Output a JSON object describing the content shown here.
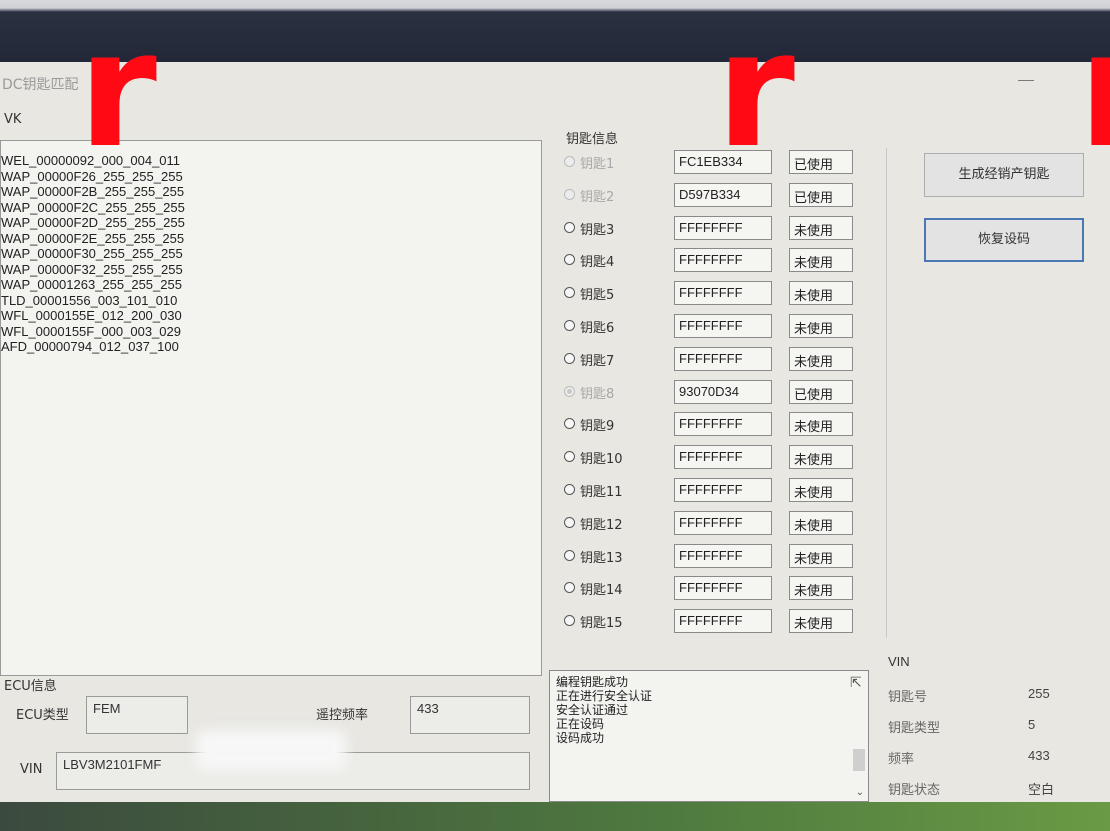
{
  "window": {
    "title": "DC钥匙匹配"
  },
  "list_panel": {
    "label": "VK",
    "items": [
      "WEL_00000092_000_004_011",
      "WAP_00000F26_255_255_255",
      "WAP_00000F2B_255_255_255",
      "WAP_00000F2C_255_255_255",
      "WAP_00000F2D_255_255_255",
      "WAP_00000F2E_255_255_255",
      "WAP_00000F30_255_255_255",
      "WAP_00000F32_255_255_255",
      "WAP_00001263_255_255_255",
      "TLD_00001556_003_101_010",
      "WFL_0000155E_012_200_030",
      "WFL_0000155F_000_003_029",
      "AFD_00000794_012_037_100"
    ]
  },
  "key_info": {
    "label": "钥匙信息",
    "keys": [
      {
        "name": "钥匙1",
        "code": "FC1EB334",
        "status": "已使用",
        "enabled": false,
        "checked": false
      },
      {
        "name": "钥匙2",
        "code": "D597B334",
        "status": "已使用",
        "enabled": false,
        "checked": false
      },
      {
        "name": "钥匙3",
        "code": "FFFFFFFF",
        "status": "未使用",
        "enabled": true,
        "checked": false
      },
      {
        "name": "钥匙4",
        "code": "FFFFFFFF",
        "status": "未使用",
        "enabled": true,
        "checked": false
      },
      {
        "name": "钥匙5",
        "code": "FFFFFFFF",
        "status": "未使用",
        "enabled": true,
        "checked": false
      },
      {
        "name": "钥匙6",
        "code": "FFFFFFFF",
        "status": "未使用",
        "enabled": true,
        "checked": false
      },
      {
        "name": "钥匙7",
        "code": "FFFFFFFF",
        "status": "未使用",
        "enabled": true,
        "checked": false
      },
      {
        "name": "钥匙8",
        "code": "93070D34",
        "status": "已使用",
        "enabled": false,
        "checked": true
      },
      {
        "name": "钥匙9",
        "code": "FFFFFFFF",
        "status": "未使用",
        "enabled": true,
        "checked": false
      },
      {
        "name": "钥匙10",
        "code": "FFFFFFFF",
        "status": "未使用",
        "enabled": true,
        "checked": false
      },
      {
        "name": "钥匙11",
        "code": "FFFFFFFF",
        "status": "未使用",
        "enabled": true,
        "checked": false
      },
      {
        "name": "钥匙12",
        "code": "FFFFFFFF",
        "status": "未使用",
        "enabled": true,
        "checked": false
      },
      {
        "name": "钥匙13",
        "code": "FFFFFFFF",
        "status": "未使用",
        "enabled": true,
        "checked": false
      },
      {
        "name": "钥匙14",
        "code": "FFFFFFFF",
        "status": "未使用",
        "enabled": true,
        "checked": false
      },
      {
        "name": "钥匙15",
        "code": "FFFFFFFF",
        "status": "未使用",
        "enabled": true,
        "checked": false
      }
    ]
  },
  "buttons": {
    "generate_label": "生成经销产钥匙",
    "restore_label": "恢复设码"
  },
  "log": {
    "lines": [
      "编程钥匙成功",
      "正在进行安全认证",
      "安全认证通过",
      "正在设码",
      "设码成功"
    ]
  },
  "ecu": {
    "label": "ECU信息",
    "type_label": "ECU类型",
    "type_value": "FEM",
    "freq_label": "遥控频率",
    "freq_value": "433",
    "vin_label": "VIN",
    "vin_value": "LBV3M2101FMF"
  },
  "vin_info": {
    "title": "VIN",
    "rows": [
      {
        "label": "钥匙号",
        "value": "255"
      },
      {
        "label": "钥匙类型",
        "value": "5"
      },
      {
        "label": "频率",
        "value": "433"
      },
      {
        "label": "钥匙状态",
        "value": "空白"
      }
    ]
  },
  "overlay": {
    "mark": "r"
  },
  "colors": {
    "overlay_red": "#ff0a14",
    "focus_border": "#4a78b3",
    "window_bg": "#e8e7e2"
  }
}
